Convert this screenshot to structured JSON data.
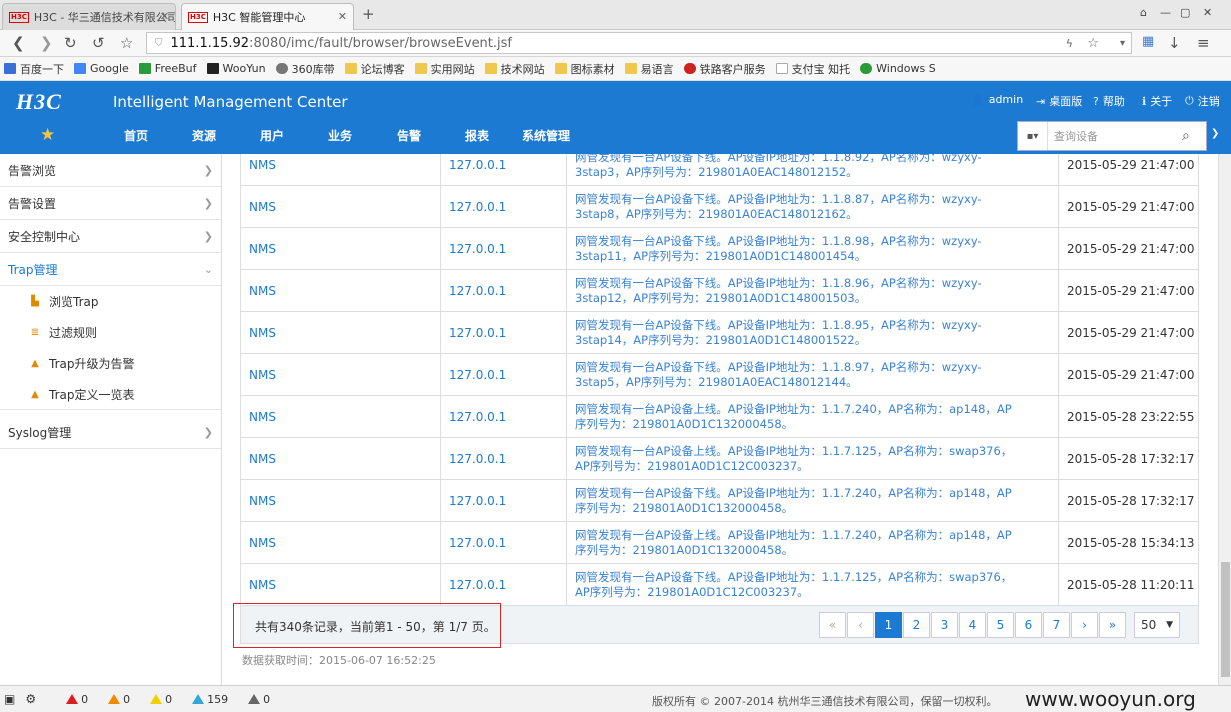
{
  "browser": {
    "tabs": [
      {
        "label": "H3C - 华三通信技术有限公司",
        "favicon": "H3C"
      },
      {
        "label": "H3C 智能管理中心",
        "favicon": "H3C"
      }
    ],
    "url_host": "111.1.15.92",
    "url_rest": ":8080/imc/fault/browser/browseEvent.jsf",
    "bookmarks": [
      "百度一下",
      "Google",
      "FreeBuf",
      "WooYun",
      "360库带",
      "论坛博客",
      "实用网站",
      "技术网站",
      "图标素材",
      "易语言",
      "铁路客户服务",
      "支付宝 知托",
      "Windows S"
    ]
  },
  "header": {
    "logo": "H3C",
    "title": "Intelligent Management Center",
    "user": "admin",
    "desktop": "桌面版",
    "help": "帮助",
    "about": "关于",
    "logout": "注销",
    "menu": [
      "首页",
      "资源",
      "用户",
      "业务",
      "告警",
      "报表",
      "系统管理"
    ],
    "search_placeholder": "查询设备"
  },
  "sidebar": {
    "items": [
      {
        "label": "告警浏览"
      },
      {
        "label": "告警设置"
      },
      {
        "label": "安全控制中心"
      },
      {
        "label": "Trap管理"
      },
      {
        "label": "Syslog管理"
      }
    ],
    "subitems": [
      {
        "label": "浏览Trap"
      },
      {
        "label": "过滤规则"
      },
      {
        "label": "Trap升级为告警"
      },
      {
        "label": "Trap定义一览表"
      }
    ]
  },
  "table": {
    "rows": [
      {
        "source": "NMS",
        "ip": "127.0.0.1",
        "desc1": "网管发现有一台AP设备下线。AP设备IP地址为：1.1.8.92，AP名称为：wzyxy-",
        "desc2": "3stap3，AP序列号为：219801A0EAC148012152。",
        "time": "2015-05-29 21:47:00"
      },
      {
        "source": "NMS",
        "ip": "127.0.0.1",
        "desc1": "网管发现有一台AP设备下线。AP设备IP地址为：1.1.8.87，AP名称为：wzyxy-",
        "desc2": "3stap8，AP序列号为：219801A0EAC148012162。",
        "time": "2015-05-29 21:47:00"
      },
      {
        "source": "NMS",
        "ip": "127.0.0.1",
        "desc1": "网管发现有一台AP设备下线。AP设备IP地址为：1.1.8.98，AP名称为：wzyxy-",
        "desc2": "3stap11，AP序列号为：219801A0D1C148001454。",
        "time": "2015-05-29 21:47:00"
      },
      {
        "source": "NMS",
        "ip": "127.0.0.1",
        "desc1": "网管发现有一台AP设备下线。AP设备IP地址为：1.1.8.96，AP名称为：wzyxy-",
        "desc2": "3stap12，AP序列号为：219801A0D1C148001503。",
        "time": "2015-05-29 21:47:00"
      },
      {
        "source": "NMS",
        "ip": "127.0.0.1",
        "desc1": "网管发现有一台AP设备下线。AP设备IP地址为：1.1.8.95，AP名称为：wzyxy-",
        "desc2": "3stap14，AP序列号为：219801A0D1C148001522。",
        "time": "2015-05-29 21:47:00"
      },
      {
        "source": "NMS",
        "ip": "127.0.0.1",
        "desc1": "网管发现有一台AP设备下线。AP设备IP地址为：1.1.8.97，AP名称为：wzyxy-",
        "desc2": "3stap5，AP序列号为：219801A0EAC148012144。",
        "time": "2015-05-29 21:47:00"
      },
      {
        "source": "NMS",
        "ip": "127.0.0.1",
        "desc1": "网管发现有一台AP设备上线。AP设备IP地址为：1.1.7.240，AP名称为：ap148，AP",
        "desc2": "序列号为：219801A0D1C132000458。",
        "time": "2015-05-28 23:22:55"
      },
      {
        "source": "NMS",
        "ip": "127.0.0.1",
        "desc1": "网管发现有一台AP设备上线。AP设备IP地址为：1.1.7.125，AP名称为：swap376，",
        "desc2": "AP序列号为：219801A0D1C12C003237。",
        "time": "2015-05-28 17:32:17"
      },
      {
        "source": "NMS",
        "ip": "127.0.0.1",
        "desc1": "网管发现有一台AP设备下线。AP设备IP地址为：1.1.7.240，AP名称为：ap148，AP",
        "desc2": "序列号为：219801A0D1C132000458。",
        "time": "2015-05-28 17:32:17"
      },
      {
        "source": "NMS",
        "ip": "127.0.0.1",
        "desc1": "网管发现有一台AP设备上线。AP设备IP地址为：1.1.7.240，AP名称为：ap148，AP",
        "desc2": "序列号为：219801A0D1C132000458。",
        "time": "2015-05-28 15:34:13"
      },
      {
        "source": "NMS",
        "ip": "127.0.0.1",
        "desc1": "网管发现有一台AP设备下线。AP设备IP地址为：1.1.7.125，AP名称为：swap376，",
        "desc2": "AP序列号为：219801A0D1C12C003237。",
        "time": "2015-05-28 11:20:11"
      }
    ]
  },
  "pager": {
    "info": "共有340条记录，当前第1 - 50，第 1/7 页。",
    "pages": [
      "1",
      "2",
      "3",
      "4",
      "5",
      "6",
      "7"
    ],
    "current": "1",
    "page_size": "50"
  },
  "fetched": "数据获取时间：2015-06-07 16:52:25",
  "status": {
    "counts": [
      {
        "value": "0",
        "color": "#d81e1e"
      },
      {
        "value": "0",
        "color": "#f08a00"
      },
      {
        "value": "0",
        "color": "#f0d000"
      },
      {
        "value": "159",
        "color": "#2fa8d8"
      },
      {
        "value": "0",
        "color": "#666666"
      }
    ],
    "copyright": "版权所有 © 2007-2014 杭州华三通信技术有限公司，保留一切权利。"
  },
  "watermark": "www.wooyun.org"
}
